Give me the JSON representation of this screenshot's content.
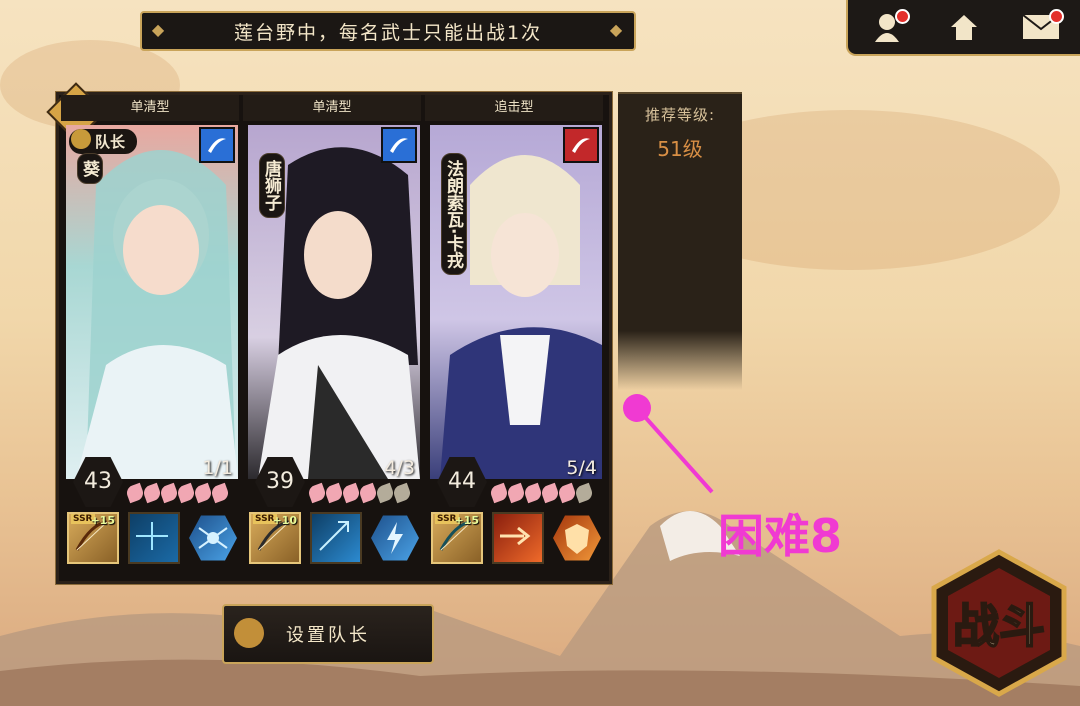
{
  "banner": {
    "text": "莲台野中，每名武士只能出战1次"
  },
  "top_bar": {
    "items": [
      {
        "name": "character-icon",
        "badge": true
      },
      {
        "name": "home-icon",
        "badge": false
      },
      {
        "name": "mail-icon",
        "badge": true
      }
    ]
  },
  "team": {
    "warning_symbol": "!",
    "captain_label": "队长",
    "cards": [
      {
        "type": "单清型",
        "name": "葵",
        "level": "43",
        "count": "1/1",
        "stars_filled": 6,
        "stars_total": 6,
        "weapon_plus": "+15",
        "weapon_rarity": "SSR",
        "element_color": "#2a6fd6",
        "portrait_color": "#a8d7d3"
      },
      {
        "type": "单清型",
        "name": "唐狮子",
        "level": "39",
        "count": "4/3",
        "stars_filled": 4,
        "stars_total": 6,
        "weapon_plus": "+10",
        "weapon_rarity": "SSR",
        "element_color": "#2a6fd6",
        "portrait_color": "#b7a6cf"
      },
      {
        "type": "追击型",
        "name": "法朗索瓦·卡戎",
        "level": "44",
        "count": "5/4",
        "stars_filled": 5,
        "stars_total": 6,
        "weapon_plus": "+15",
        "weapon_rarity": "SSR",
        "element_color": "#c2282a",
        "portrait_color": "#b6a9d6"
      }
    ]
  },
  "recommend": {
    "title": "推荐等级:",
    "value": "51级"
  },
  "annotation": {
    "text": "困难8",
    "color": "#f03ad2"
  },
  "buttons": {
    "set_captain": "设置队长",
    "fight": "战斗"
  }
}
